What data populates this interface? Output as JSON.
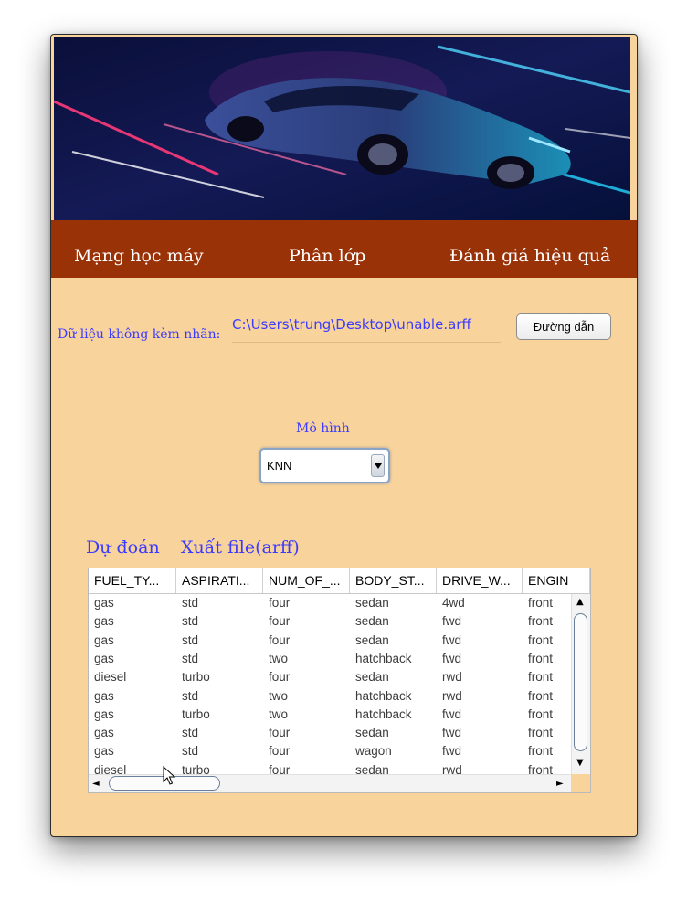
{
  "menu": {
    "neural_net": "Mạng học máy",
    "classify": "Phân lớp",
    "evaluate": "Đánh giá hiệu quả"
  },
  "unlabeled": {
    "label": "Dữ liệu không kèm nhãn:",
    "path": "C:\\Users\\trung\\Desktop\\unable.arff",
    "browse_button": "Đường dẫn"
  },
  "model": {
    "label": "Mô hình",
    "selected": "KNN"
  },
  "actions": {
    "predict": "Dự đoán",
    "export": "Xuất file(arff)"
  },
  "table": {
    "columns": [
      "FUEL_TY...",
      "ASPIRATI...",
      "NUM_OF_...",
      "BODY_ST...",
      "DRIVE_W...",
      "ENGIN"
    ],
    "rows": [
      [
        "gas",
        "std",
        "four",
        "sedan",
        "4wd",
        "front"
      ],
      [
        "gas",
        "std",
        "four",
        "sedan",
        "fwd",
        "front"
      ],
      [
        "gas",
        "std",
        "four",
        "sedan",
        "fwd",
        "front"
      ],
      [
        "gas",
        "std",
        "two",
        "hatchback",
        "fwd",
        "front"
      ],
      [
        "diesel",
        "turbo",
        "four",
        "sedan",
        "rwd",
        "front"
      ],
      [
        "gas",
        "std",
        "two",
        "hatchback",
        "rwd",
        "front"
      ],
      [
        "gas",
        "turbo",
        "two",
        "hatchback",
        "fwd",
        "front"
      ],
      [
        "gas",
        "std",
        "four",
        "sedan",
        "fwd",
        "front"
      ],
      [
        "gas",
        "std",
        "four",
        "wagon",
        "fwd",
        "front"
      ],
      [
        "diesel",
        "turbo",
        "four",
        "sedan",
        "rwd",
        "front"
      ]
    ]
  },
  "colors": {
    "background": "#f9d39c",
    "menubar": "#9a3208",
    "accent_text": "#3b3bff"
  }
}
